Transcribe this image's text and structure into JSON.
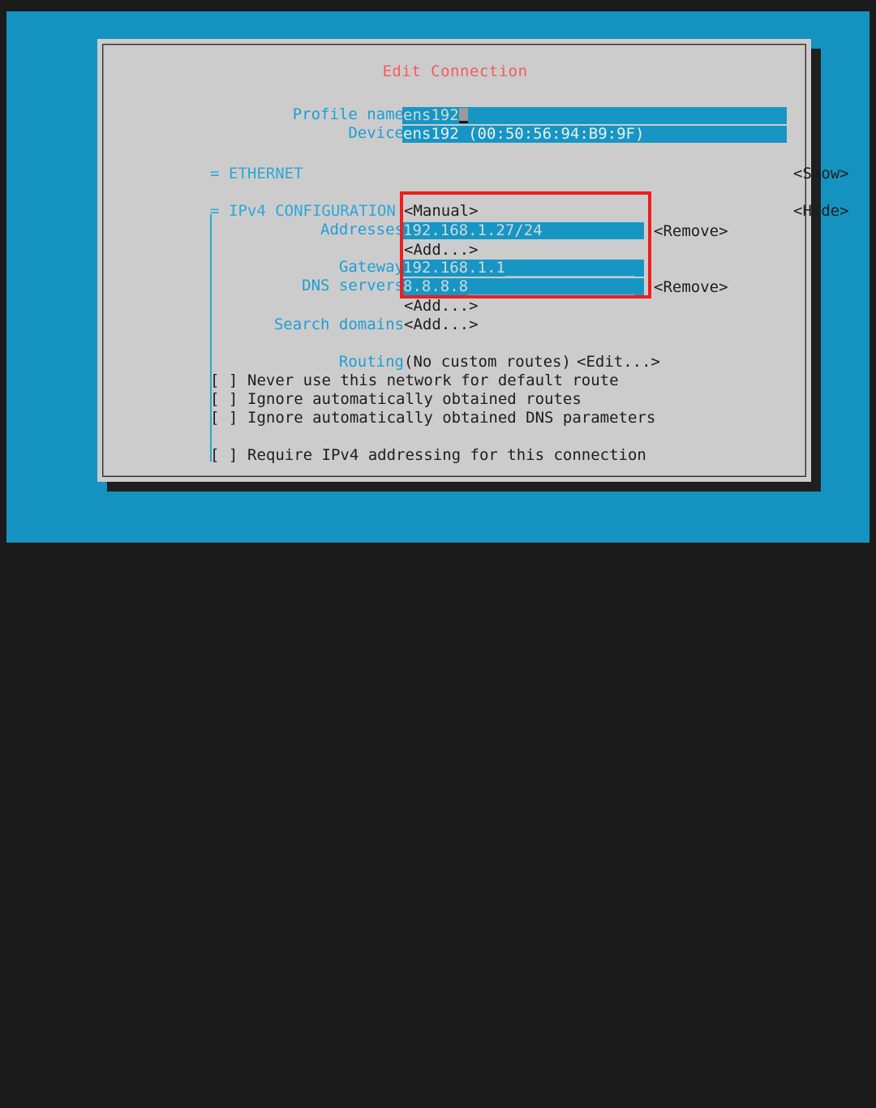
{
  "window": {
    "title": "Edit Connection",
    "title_color": "#f25e5e",
    "background_color": "#1593c0",
    "dialog_color": "#cccccc"
  },
  "form": {
    "profile_name": {
      "label": "Profile name",
      "value": "ens192",
      "tail": "____"
    },
    "device": {
      "label": "Device",
      "value": "ens192 (00:50:56:94:B9:9F)",
      "tail": ""
    }
  },
  "sections": [
    {
      "glyph": "=",
      "name": "ETHERNET",
      "toggle": "<Show>"
    },
    {
      "glyph": "=",
      "name": "IPv4 CONFIGURATION",
      "toggle": "<Hide>",
      "mode": "<Manual>"
    }
  ],
  "ipv4": {
    "addresses_label": "Addresses",
    "addresses": [
      {
        "value": "192.168.1.27/24",
        "tail": "",
        "remove": "<Remove>"
      }
    ],
    "addresses_add": "<Add...>",
    "gateway_label": "Gateway",
    "gateway": {
      "value": "192.168.1.1",
      "tail": "______________"
    },
    "dns_label": "DNS servers",
    "dns_servers": [
      {
        "value": "8.8.8.8",
        "tail": "__________________",
        "remove": "<Remove>"
      }
    ],
    "dns_add": "<Add...>",
    "search_domains_label": "Search domains",
    "search_domains_add": "<Add...>"
  },
  "routing": {
    "label": "Routing",
    "summary": "(No custom routes)",
    "edit": "<Edit...>"
  },
  "checkboxes": [
    {
      "state": "[ ]",
      "label": "Never use this network for default route",
      "checked": false
    },
    {
      "state": "[ ]",
      "label": "Ignore automatically obtained routes",
      "checked": false
    },
    {
      "state": "[ ]",
      "label": "Ignore automatically obtained DNS parameters",
      "checked": false
    },
    {
      "state": "[ ]",
      "label": "Require IPv4 addressing for this connection",
      "checked": false
    }
  ],
  "scrollbar": {
    "up_arrow": "↑",
    "down_arrow": "↓"
  },
  "annotation": {
    "color": "#ef1d1d",
    "note": "highlight-rectangle-around-ipv4-manual-fields"
  }
}
